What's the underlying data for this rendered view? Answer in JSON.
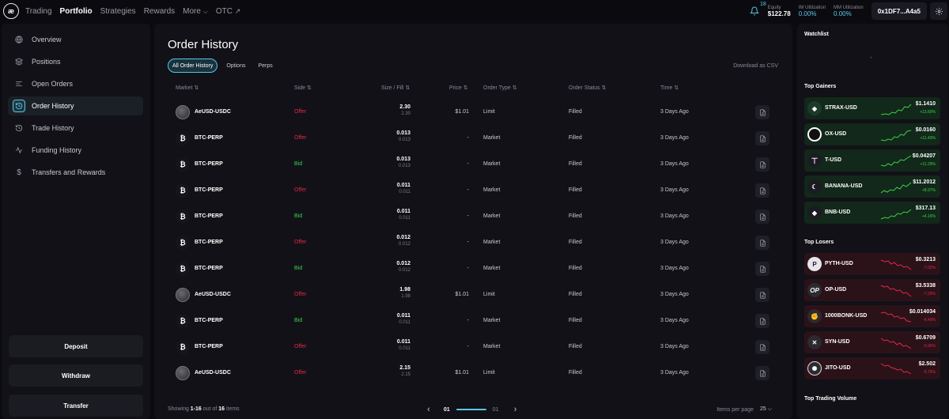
{
  "nav": {
    "logo": "æ",
    "items": [
      {
        "label": "Trading",
        "active": false
      },
      {
        "label": "Portfolio",
        "active": true
      },
      {
        "label": "Strategies",
        "active": false
      },
      {
        "label": "Rewards",
        "active": false
      },
      {
        "label": "More",
        "active": false
      },
      {
        "label": "OTC",
        "active": false
      }
    ]
  },
  "header": {
    "notification_count": "18",
    "equity_label": "Equity",
    "equity_value": "$122.78",
    "im_label": "IM Utilization",
    "im_value": "0.00%",
    "mm_label": "MM Utilization",
    "mm_value": "0.00%",
    "wallet": "0x1DF7...A4a5"
  },
  "sidebar": {
    "items": [
      {
        "label": "Overview",
        "icon": "globe-icon",
        "active": false
      },
      {
        "label": "Positions",
        "icon": "layers-icon",
        "active": false
      },
      {
        "label": "Open Orders",
        "icon": "list-icon",
        "active": false
      },
      {
        "label": "Order History",
        "icon": "history-icon",
        "active": true
      },
      {
        "label": "Trade History",
        "icon": "clock-icon",
        "active": false
      },
      {
        "label": "Funding History",
        "icon": "activity-icon",
        "active": false
      },
      {
        "label": "Transfers and Rewards",
        "icon": "dollar-icon",
        "active": false
      }
    ],
    "buttons": {
      "deposit": "Deposit",
      "withdraw": "Withdraw",
      "transfer": "Transfer"
    }
  },
  "main": {
    "title": "Order History",
    "tabs": [
      {
        "label": "All Order History",
        "active": true
      },
      {
        "label": "Options",
        "active": false
      },
      {
        "label": "Perps",
        "active": false
      }
    ],
    "download": "Download as CSV",
    "columns": {
      "market": "Market",
      "side": "Side",
      "size": "Size / Fill",
      "price": "Price",
      "type": "Order Type",
      "status": "Order Status",
      "time": "Time"
    },
    "rows": [
      {
        "market": "AeUSD-USDC",
        "icon": "aeusd",
        "side": "Offer",
        "size": "2.30",
        "fill": "2.30",
        "price": "$1.01",
        "type": "Limit",
        "status": "Filled",
        "time": "3 Days Ago"
      },
      {
        "market": "BTC-PERP",
        "icon": "btc",
        "side": "Offer",
        "size": "0.013",
        "fill": "0.013",
        "price": "-",
        "type": "Market",
        "status": "Filled",
        "time": "3 Days Ago"
      },
      {
        "market": "BTC-PERP",
        "icon": "btc",
        "side": "Bid",
        "size": "0.013",
        "fill": "0.013",
        "price": "-",
        "type": "Market",
        "status": "Filled",
        "time": "3 Days Ago"
      },
      {
        "market": "BTC-PERP",
        "icon": "btc",
        "side": "Offer",
        "size": "0.011",
        "fill": "0.011",
        "price": "-",
        "type": "Market",
        "status": "Filled",
        "time": "3 Days Ago"
      },
      {
        "market": "BTC-PERP",
        "icon": "btc",
        "side": "Bid",
        "size": "0.011",
        "fill": "0.011",
        "price": "-",
        "type": "Market",
        "status": "Filled",
        "time": "3 Days Ago"
      },
      {
        "market": "BTC-PERP",
        "icon": "btc",
        "side": "Offer",
        "size": "0.012",
        "fill": "0.012",
        "price": "-",
        "type": "Market",
        "status": "Filled",
        "time": "3 Days Ago"
      },
      {
        "market": "BTC-PERP",
        "icon": "btc",
        "side": "Bid",
        "size": "0.012",
        "fill": "0.012",
        "price": "-",
        "type": "Market",
        "status": "Filled",
        "time": "3 Days Ago"
      },
      {
        "market": "AeUSD-USDC",
        "icon": "aeusd",
        "side": "Offer",
        "size": "1.98",
        "fill": "1.98",
        "price": "$1.01",
        "type": "Limit",
        "status": "Filled",
        "time": "3 Days Ago"
      },
      {
        "market": "BTC-PERP",
        "icon": "btc",
        "side": "Bid",
        "size": "0.011",
        "fill": "0.011",
        "price": "-",
        "type": "Market",
        "status": "Filled",
        "time": "3 Days Ago"
      },
      {
        "market": "BTC-PERP",
        "icon": "btc",
        "side": "Offer",
        "size": "0.011",
        "fill": "0.011",
        "price": "-",
        "type": "Market",
        "status": "Filled",
        "time": "3 Days Ago"
      },
      {
        "market": "AeUSD-USDC",
        "icon": "aeusd",
        "side": "Offer",
        "size": "2.15",
        "fill": "2.15",
        "price": "$1.01",
        "type": "Limit",
        "status": "Filled",
        "time": "3 Days Ago"
      }
    ],
    "footer": {
      "showing_prefix": "Showing ",
      "showing_range": "1-16",
      "showing_mid": " out of ",
      "showing_total": "16",
      "showing_suffix": " items",
      "page_current": "01",
      "page_total": "01",
      "items_per_page_label": "Items per page",
      "items_per_page_value": "25"
    }
  },
  "right_panel": {
    "watchlist_title": "Watchlist",
    "watchlist_empty": "-",
    "gainers_title": "Top Gainers",
    "gainers": [
      {
        "name": "STRAX-USD",
        "price": "$1.1410",
        "change": "+13.60%",
        "icon": "strax-icon"
      },
      {
        "name": "OX-USD",
        "price": "$0.0160",
        "change": "+11.43%",
        "icon": "ox-icon"
      },
      {
        "name": "T-USD",
        "price": "$0.04207",
        "change": "+11.29%",
        "icon": "t-icon"
      },
      {
        "name": "BANANA-USD",
        "price": "$11.2012",
        "change": "+8.97%",
        "icon": "banana-icon"
      },
      {
        "name": "BNB-USD",
        "price": "$317.13",
        "change": "+4.16%",
        "icon": "bnb-icon"
      }
    ],
    "losers_title": "Top Losers",
    "losers": [
      {
        "name": "PYTH-USD",
        "price": "$0.3213",
        "change": "-7.02%",
        "icon": "pyth-icon"
      },
      {
        "name": "OP-USD",
        "price": "$3.5338",
        "change": "-7.20%",
        "icon": "op-icon"
      },
      {
        "name": "1000BONK-USD",
        "price": "$0.014034",
        "change": "-6.40%",
        "icon": "bonk-icon"
      },
      {
        "name": "SYN-USD",
        "price": "$0.6709",
        "change": "-5.90%",
        "icon": "syn-icon"
      },
      {
        "name": "JITO-USD",
        "price": "$2.502",
        "change": "-5.75%",
        "icon": "jito-icon"
      }
    ],
    "volume_title": "Top Trading Volume"
  }
}
